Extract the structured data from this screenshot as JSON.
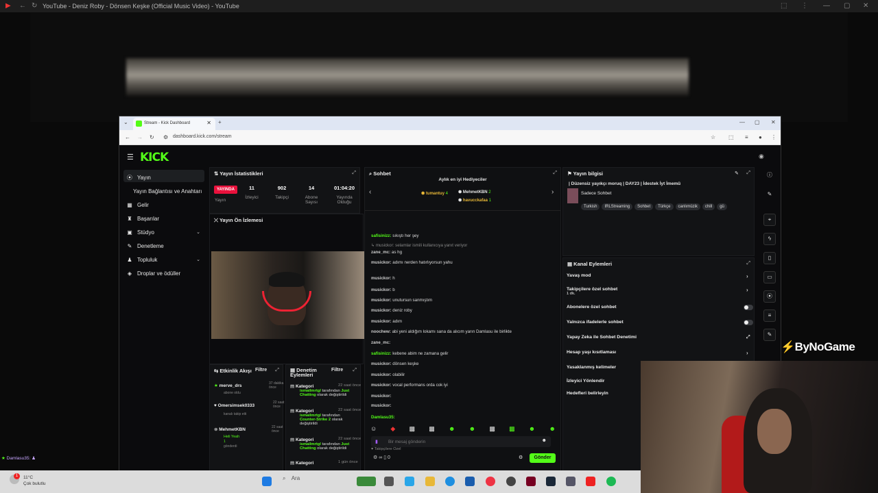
{
  "youtube": {
    "tab_title": "YouTube - Deniz Roby - Dönsen Keşke (Official Music Video) - YouTube"
  },
  "browser": {
    "tab_title": "Stream - Kick Dashboard",
    "url": "dashboard.kick.com/stream"
  },
  "kick": {
    "logo": "KICK",
    "sidebar": [
      {
        "label": "Yayın",
        "icon": "broadcast-icon"
      },
      {
        "label": "Yayın Bağlantısı ve Anahtarı",
        "icon": ""
      },
      {
        "label": "Gelir",
        "icon": "revenue-icon"
      },
      {
        "label": "Başarılar",
        "icon": "trophy-icon"
      },
      {
        "label": "Stüdyo",
        "icon": "studio-icon"
      },
      {
        "label": "Denetleme",
        "icon": "moderation-icon"
      },
      {
        "label": "Topluluk",
        "icon": "community-icon"
      },
      {
        "label": "Droplar ve ödüller",
        "icon": "drops-icon"
      }
    ],
    "stats": {
      "title": "Yayın İstatistikleri",
      "live_badge": "YAYINDA",
      "live_label": "Yayın",
      "viewers": "11",
      "viewers_label": "İzleyici",
      "followers": "902",
      "followers_label": "Takipçi",
      "subs": "14",
      "subs_label": "Abone Sayısı",
      "uptime": "01:04:20",
      "uptime_label": "Yayında Olduğu"
    },
    "preview": {
      "title": "Yayın Ön İzlemesi"
    },
    "activity": {
      "title": "Etkinlik Akışı",
      "filter": "Filtre",
      "items": [
        {
          "user": "merve_drs",
          "time": "37 dakika önce",
          "text": "abone oldu"
        },
        {
          "user": "Omersimsek0333",
          "time": "22 saat önce",
          "text": "kanalı takip etti"
        },
        {
          "user": "MehmetKBN",
          "time": "22 saat önce",
          "text": "Heli Yeah",
          "amount": "1",
          "text2": "gönderdi"
        }
      ]
    },
    "mod_actions": {
      "title": "Denetim Eylemleri",
      "filter": "Filtre",
      "items": [
        {
          "label": "Kategori",
          "time": "22 saat önce",
          "user": "ismailmrtgl",
          "mid": "tarafından",
          "cat": "Just Chatting",
          "end": "olarak değiştirildi"
        },
        {
          "label": "Kategori",
          "time": "22 saat önce",
          "user": "ismailmrtgl",
          "mid": "tarafından",
          "cat": "Counter-Strike 2",
          "end": "olarak değiştirildi"
        },
        {
          "label": "Kategori",
          "time": "22 saat önce",
          "user": "ismailmrtgl",
          "mid": "tarafından",
          "cat": "Just Chatting",
          "end": "olarak değiştirildi"
        },
        {
          "label": "Kategori",
          "time": "1 gün önce"
        }
      ]
    },
    "chat": {
      "title": "Sohbet",
      "top_gifters_title": "Aylık en iyi Hediyeciler",
      "gifter1": "tumantuy",
      "gifter1_count": "4",
      "gifter2": "MehmetKBN",
      "gifter2_count": "2",
      "gifter3": "havucckafaa",
      "gifter3_count": "1",
      "messages": [
        {
          "user": "safisinizz:",
          "text": "sıkıştı her şey",
          "green": true
        },
        {
          "sys": "musickor: selamlar ismili kullanıcıya yanıt veriyor"
        },
        {
          "user": "zane_mc:",
          "text": "as hg",
          "green": false
        },
        {
          "user": "musickor:",
          "text": "adımı nerden hatırlıyorsun yahu"
        },
        {
          "user": "musickor:",
          "text": "h"
        },
        {
          "user": "musickor:",
          "text": "b"
        },
        {
          "user": "musickor:",
          "text": "unutursun sanmıştım"
        },
        {
          "user": "musickor:",
          "text": "deniz roby"
        },
        {
          "user": "musickor:",
          "text": "adım"
        },
        {
          "user": "noochew:",
          "text": "abi yeni aldığım lokamı sana da alıcım yarın Damlasu ile birlikte"
        },
        {
          "user": "zane_mc:",
          "text": ""
        },
        {
          "user": "safisinizz:",
          "text": "kebene abim ne zamana gelir",
          "green": true
        },
        {
          "user": "musickor:",
          "text": "dönsen keşke"
        },
        {
          "user": "musickor:",
          "text": "olabilir"
        },
        {
          "user": "musickor:",
          "text": "vocal performans orda cok iyi"
        },
        {
          "user": "musickor:",
          "text": ""
        },
        {
          "user": "musickor:",
          "text": ""
        },
        {
          "user": "Damlasu35:",
          "text": "",
          "green": true
        }
      ],
      "followers_only": "Takipçilere Özel",
      "input_placeholder": "Bir mesaj gönderin",
      "count": "0",
      "send": "Gönder"
    },
    "stream_info": {
      "title": "Yayın bilgisi",
      "stream_title": "| Düzensiz yayıkçı moruq | DAY23 | İdestek İyt İmemü",
      "category": "Sadece Sohbet",
      "tags": [
        "Turkish",
        "IRLStreaming",
        "Sohbet",
        "Türkçe",
        "canlımüzik",
        "chill",
        "gü"
      ]
    },
    "channel_actions": {
      "title": "Kanal Eylemleri",
      "items": [
        {
          "label": "Yavaş mod",
          "type": "arrow"
        },
        {
          "label": "Takipçilere özel sohbet",
          "sub": "1 dk.",
          "type": "arrow"
        },
        {
          "label": "Abonelere özel sohbet",
          "type": "toggle"
        },
        {
          "label": "Yalnızca ifadelerle sohbet",
          "type": "toggle"
        },
        {
          "label": "Yapay Zeka ile Sohbet Denetimi",
          "type": "ext"
        },
        {
          "label": "Hesap yaşı kısıtlaması",
          "type": "arrow"
        },
        {
          "label": "Yasaklanmış kelimeler",
          "type": ""
        },
        {
          "label": "İzleyici Yönlendir",
          "type": ""
        },
        {
          "label": "Hedefleri belirleyin",
          "type": ""
        }
      ]
    }
  },
  "overlay": {
    "brand": "ByNoGame",
    "chat_bottom": "Damlasu35:"
  },
  "taskbar": {
    "temp": "11°C",
    "weather": "Çok bulutlu",
    "search": "Ara"
  }
}
